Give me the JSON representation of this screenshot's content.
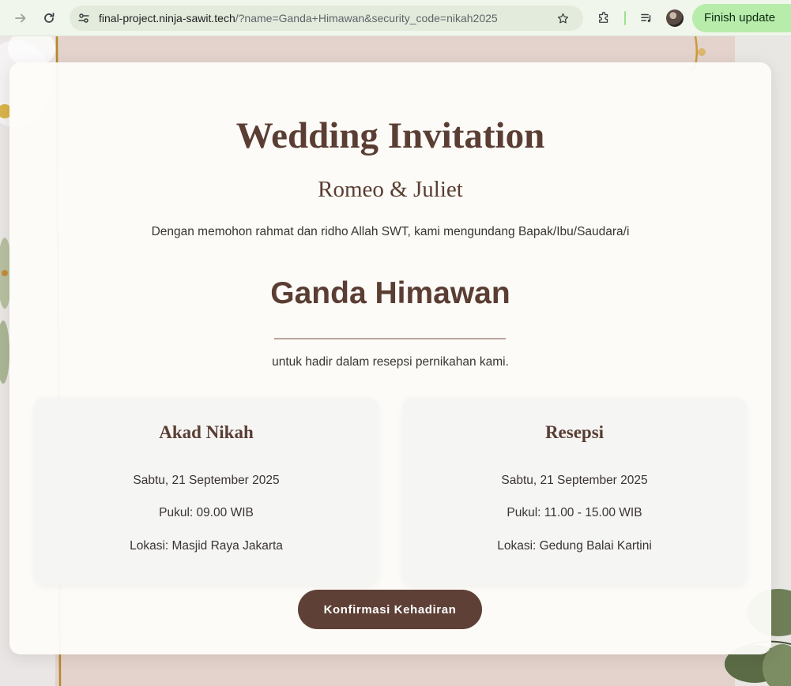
{
  "browser": {
    "url_host": "final-project.ninja-sawit.tech",
    "url_rest": "/?name=Ganda+Himawan&security_code=nikah2025",
    "finish_update_label": "Finish update"
  },
  "invitation": {
    "title": "Wedding Invitation",
    "couple": "Romeo & Juliet",
    "intro": "Dengan memohon rahmat dan ridho Allah SWT, kami mengundang Bapak/Ibu/Saudara/i",
    "guest_name": "Ganda Himawan",
    "outro": "untuk hadir dalam resepsi pernikahan kami."
  },
  "events": [
    {
      "title": "Akad Nikah",
      "date": "Sabtu, 21 September 2025",
      "time": "Pukul: 09.00 WIB",
      "location": "Lokasi: Masjid Raya Jakarta"
    },
    {
      "title": "Resepsi",
      "date": "Sabtu, 21 September 2025",
      "time": "Pukul: 11.00 - 15.00 WIB",
      "location": "Lokasi: Gedung Balai Kartini"
    }
  ],
  "confirm_button": "Konfirmasi Kehadiran",
  "colors": {
    "primary_brown": "#5e4037",
    "heading_brown": "#5a3d33",
    "card_background": "#fdfcf9",
    "event_background": "#f5f5f4"
  },
  "icons": [
    "forward-icon",
    "reload-icon",
    "site-info-icon",
    "bookmark-star-icon",
    "extensions-icon",
    "media-controls-icon"
  ]
}
